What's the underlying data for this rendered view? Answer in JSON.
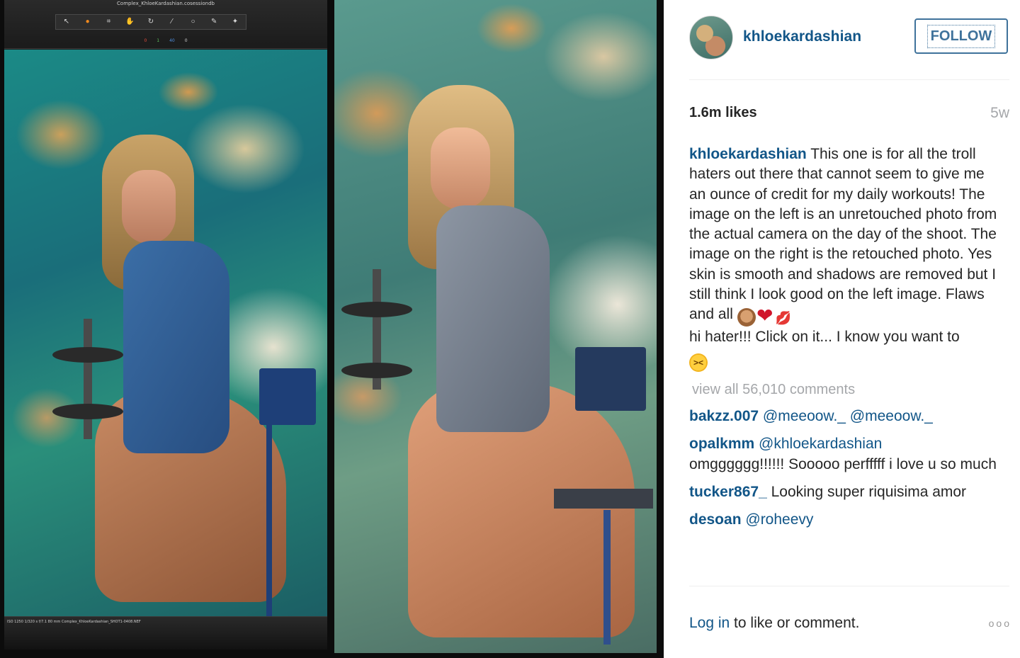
{
  "editor": {
    "filename": "Complex_KhloeKardashian.cosessiondb",
    "tool_icons": [
      "pointer-icon",
      "crop-icon",
      "hand-icon",
      "rotate-icon",
      "spot-icon",
      "brush-icon",
      "eyedropper-icon",
      "pen-icon",
      "wand-icon"
    ],
    "counts": [
      "0",
      "1",
      "40",
      "0"
    ],
    "meta": "ISO 1250   1/320 s   f/7.1   80 mm                Complex_KhloeKardashian_SHOT1-0408.NEF"
  },
  "post": {
    "author": "khloekardashian",
    "follow_label": "FOLLOW",
    "likes": "1.6m likes",
    "time_ago": "5w",
    "caption_user": "khloekardashian",
    "caption_text": "This one is for all the troll haters out there that cannot seem to give me an ounce of credit for my daily workouts! The image on the left is an unretouched photo from the actual camera on the day of the shoot. The image on the right is the retouched photo. Yes skin is smooth and shadows are removed but I still think I look good on the left image. Flaws and all",
    "caption_text_2": "hi hater!!! Click on it... I know you want to",
    "view_all": "view all 56,010 comments",
    "comments": [
      {
        "user": "bakzz.007",
        "text": "@meeoow._ @meeoow._",
        "is_mention": true
      },
      {
        "user": "opalkmm",
        "text": "@khloekardashian",
        "is_mention": true
      },
      {
        "user": "",
        "text": "omgggggg!!!!!! Sooooo perfffff i love u so much",
        "is_mention": false
      },
      {
        "user": "tucker867_",
        "text": "Looking super riquisima amor",
        "is_mention": false
      },
      {
        "user": "desoan",
        "text": "@roheevy",
        "is_mention": true
      }
    ],
    "login_link": "Log in",
    "login_rest": " to like or comment.",
    "more_options": "ooo"
  },
  "colors": {
    "link_blue": "#125688",
    "follow_blue": "#3f729b",
    "muted_gray": "#a5a7aa",
    "text": "#262626"
  }
}
